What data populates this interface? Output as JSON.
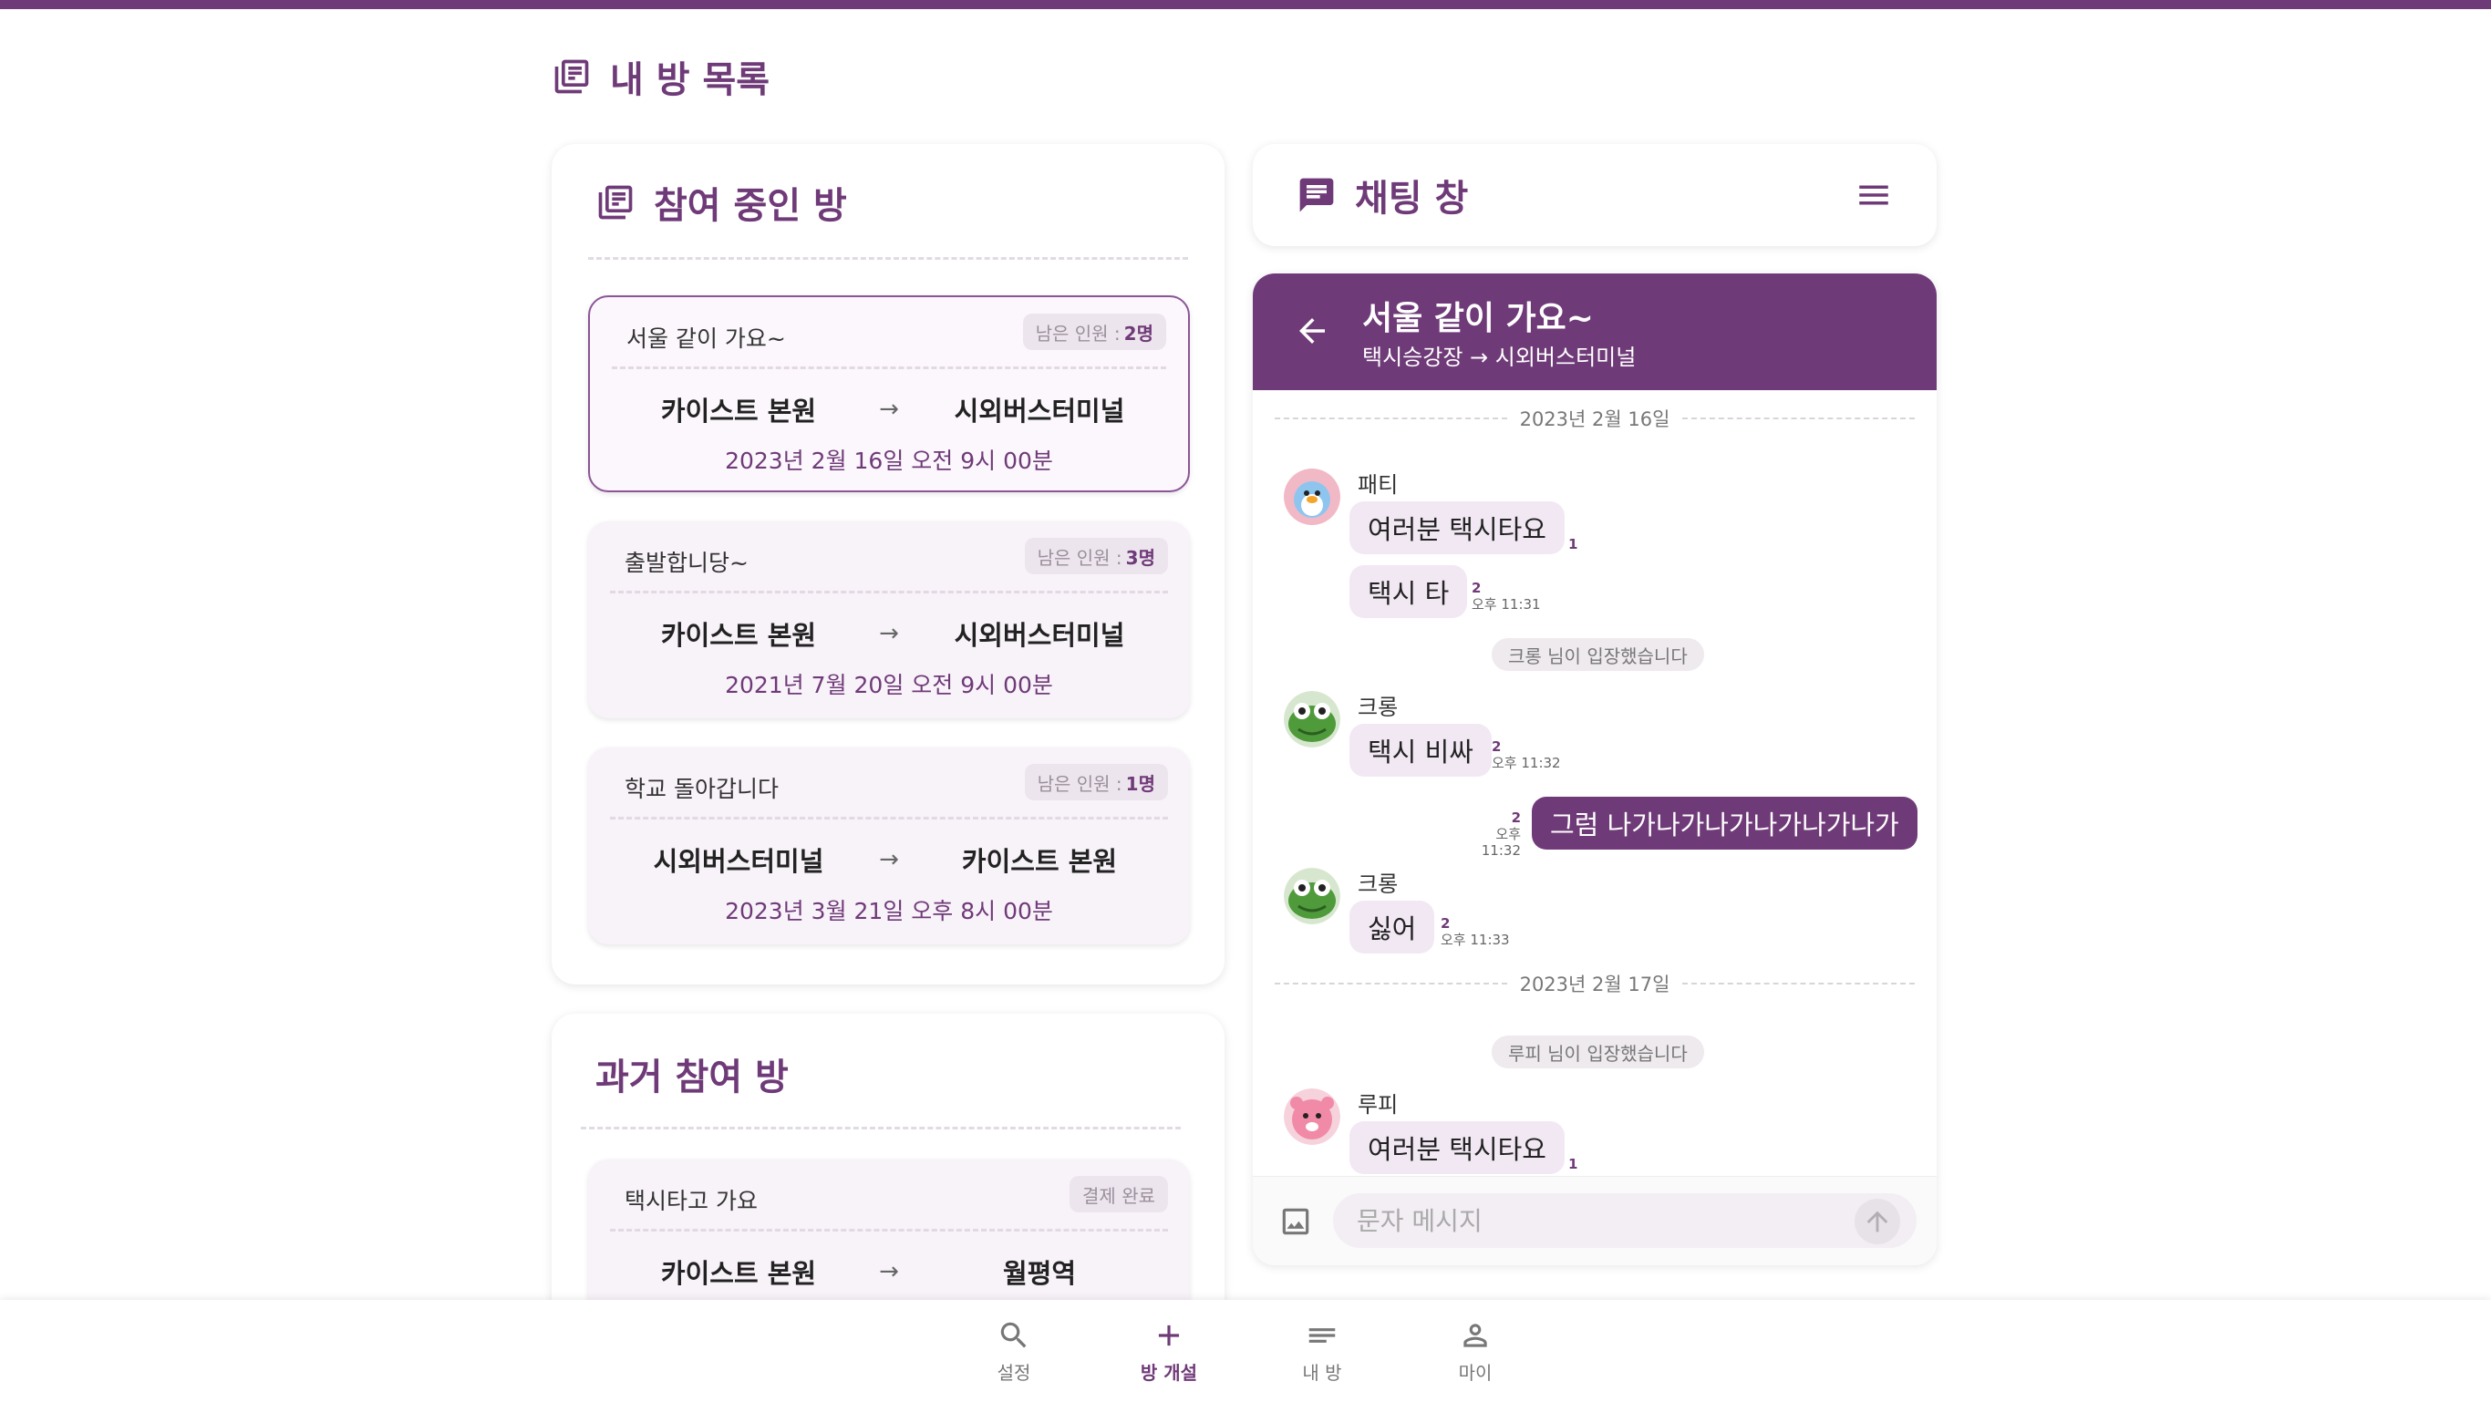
{
  "page": {
    "title": "내 방 목록"
  },
  "colors": {
    "accent": "#6f3a78",
    "bubble_in": "#f2e8f4",
    "room_bg": "#f8f2f9"
  },
  "active_rooms": {
    "title": "참여 중인 방",
    "rooms": [
      {
        "name": "서울 같이 가요~",
        "badge_label": "남은 인원 :",
        "badge_value": "2명",
        "from": "카이스트 본원",
        "arrow": "→",
        "to": "시외버스터미널",
        "datetime": "2023년 2월 16일 오전 9시 00분",
        "active": true
      },
      {
        "name": "출발합니당~",
        "badge_label": "남은 인원 :",
        "badge_value": "3명",
        "from": "카이스트 본원",
        "arrow": "→",
        "to": "시외버스터미널",
        "datetime": "2021년 7월 20일 오전 9시 00분"
      },
      {
        "name": "학교 돌아갑니다",
        "badge_label": "남은 인원 :",
        "badge_value": "1명",
        "from": "시외버스터미널",
        "arrow": "→",
        "to": "카이스트 본원",
        "datetime": "2023년 3월 21일 오후 8시 00분"
      }
    ]
  },
  "past_rooms": {
    "title": "과거 참여 방",
    "rooms": [
      {
        "name": "택시타고 가요",
        "badge": "결제 완료",
        "from": "카이스트 본원",
        "arrow": "→",
        "to": "월평역"
      }
    ]
  },
  "chat": {
    "header_title": "채팅 창",
    "room_title": "서울 같이 가요~",
    "room_route": "택시승강장 → 시외버스터미널",
    "date1": "2023년 2월 16일",
    "date2": "2023년 2월 17일",
    "msg1": {
      "sender": "패티",
      "text": "여러분 택시타요",
      "count": "1"
    },
    "msg2": {
      "text": "택시 타",
      "count": "2",
      "time": "오후 11:31"
    },
    "notice1": "크롱 님이 입장했습니다",
    "msg3": {
      "sender": "크롱",
      "text": "택시 비싸",
      "count": "2",
      "time": "오후 11:32"
    },
    "msg4": {
      "text": "그럼 나가나가나가나가나가나가",
      "count": "2",
      "time": "오후 11:32"
    },
    "msg5": {
      "sender": "크롱",
      "text": "싫어",
      "count": "2",
      "time": "오후 11:33"
    },
    "notice2": "루피 님이 입장했습니다",
    "msg6": {
      "sender": "루피",
      "text": "여러분 택시타요",
      "count": "1"
    },
    "input_placeholder": "문자 메시지"
  },
  "nav": [
    {
      "label": "설정",
      "icon": "search-icon"
    },
    {
      "label": "방 개설",
      "icon": "plus-icon",
      "active": true
    },
    {
      "label": "내 방",
      "icon": "list-icon"
    },
    {
      "label": "마이",
      "icon": "person-icon"
    }
  ]
}
